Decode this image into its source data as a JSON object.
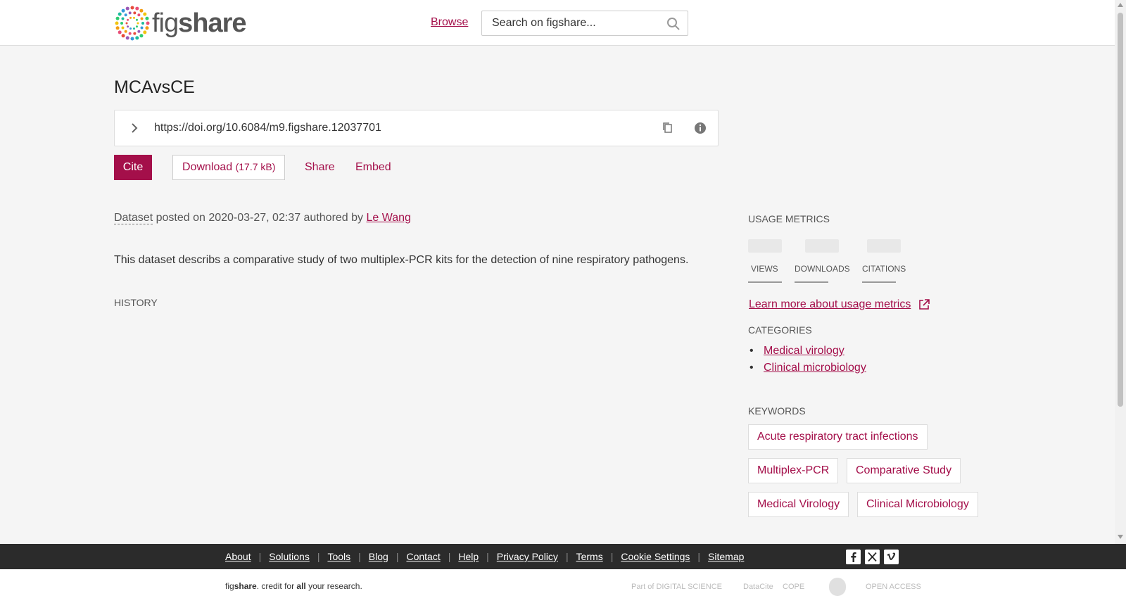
{
  "header": {
    "logo_fig": "fig",
    "logo_share": "share",
    "browse_label": "Browse",
    "search_placeholder": "Search on figshare..."
  },
  "item": {
    "title": "MCAvsCE",
    "doi": "https://doi.org/10.6084/m9.figshare.12037701",
    "actions": {
      "cite": "Cite",
      "download": "Download",
      "download_size": "(17.7 kB)",
      "share": "Share",
      "embed": "Embed"
    },
    "type": "Dataset",
    "posted_text": " posted on 2020-03-27, 02:37 authored by ",
    "author": "Le Wang",
    "description": "This dataset describs a comparative study of two multiplex-PCR kits for the detection of nine respiratory pathogens.",
    "history_label": "HISTORY"
  },
  "sidebar": {
    "usage_metrics_label": "USAGE METRICS",
    "metrics": [
      "VIEWS",
      "DOWNLOADS",
      "CITATIONS"
    ],
    "learn_more": "Learn more about usage metrics",
    "categories_label": "CATEGORIES",
    "categories": [
      "Medical virology",
      "Clinical microbiology"
    ],
    "keywords_label": "KEYWORDS",
    "keywords": [
      "Acute respiratory tract infections",
      "Multiplex-PCR",
      "Comparative Study",
      "Medical Virology",
      "Clinical Microbiology"
    ]
  },
  "footer": {
    "links": [
      "About",
      "Solutions",
      "Tools",
      "Blog",
      "Contact",
      "Help",
      "Privacy Policy",
      "Terms",
      "Cookie Settings",
      "Sitemap"
    ],
    "tagline_fig": "fig",
    "tagline_share": "share",
    "tagline_mid": ". credit for ",
    "tagline_all": "all",
    "tagline_end": " your research.",
    "social": [
      "facebook-icon",
      "x-icon",
      "vimeo-icon"
    ],
    "partners": [
      "Part of DIGITAL SCIENCE",
      "DataCite",
      "COPE",
      "",
      "OPEN ACCESS"
    ]
  },
  "colors": {
    "accent": "#a40f4a",
    "footer_bg": "#2b2b2b",
    "page_bg": "#f5f5f5"
  }
}
